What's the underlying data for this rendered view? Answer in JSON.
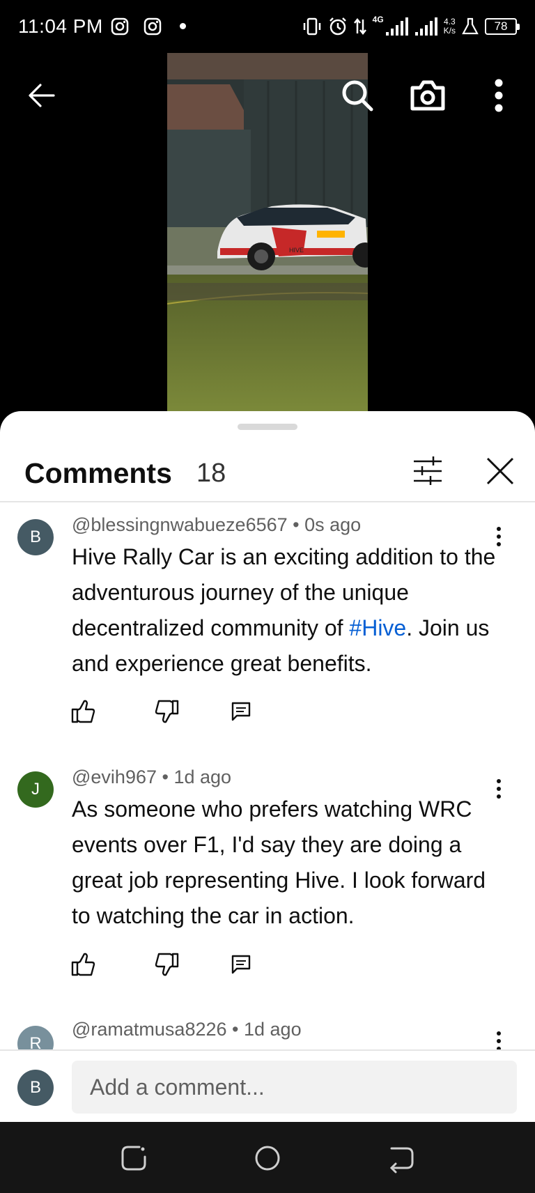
{
  "status_bar": {
    "time": "11:04 PM",
    "network": "4G",
    "speed_value": "4.3",
    "speed_unit": "K/s",
    "battery": "78"
  },
  "video": {
    "car_text": "HIVE"
  },
  "comments_sheet": {
    "title": "Comments",
    "count": "18"
  },
  "comments": [
    {
      "avatar_letter": "B",
      "avatar_color": "#455a64",
      "author": "@blessingnwabueze6567",
      "time": "0s ago",
      "text_before": "Hive Rally Car is an exciting addition to the adventurous journey of the unique decentralized community of ",
      "hashtag": "#Hive",
      "text_after": ". Join us and experience great benefits."
    },
    {
      "avatar_letter": "J",
      "avatar_color": "#33691e",
      "author": "@evih967",
      "time": "1d ago",
      "text": "As someone who prefers watching WRC events over F1, I'd say they are doing a great job representing Hive. I look forward to watching the car in action."
    },
    {
      "avatar_letter": "R",
      "avatar_color": "#78909c",
      "author": "@ramatmusa8226",
      "time": "1d ago"
    }
  ],
  "add_comment": {
    "avatar_letter": "B",
    "placeholder": "Add a comment..."
  },
  "colors": {
    "link": "#065fd4",
    "text_primary": "#0f0f0f",
    "text_secondary": "#606060"
  }
}
